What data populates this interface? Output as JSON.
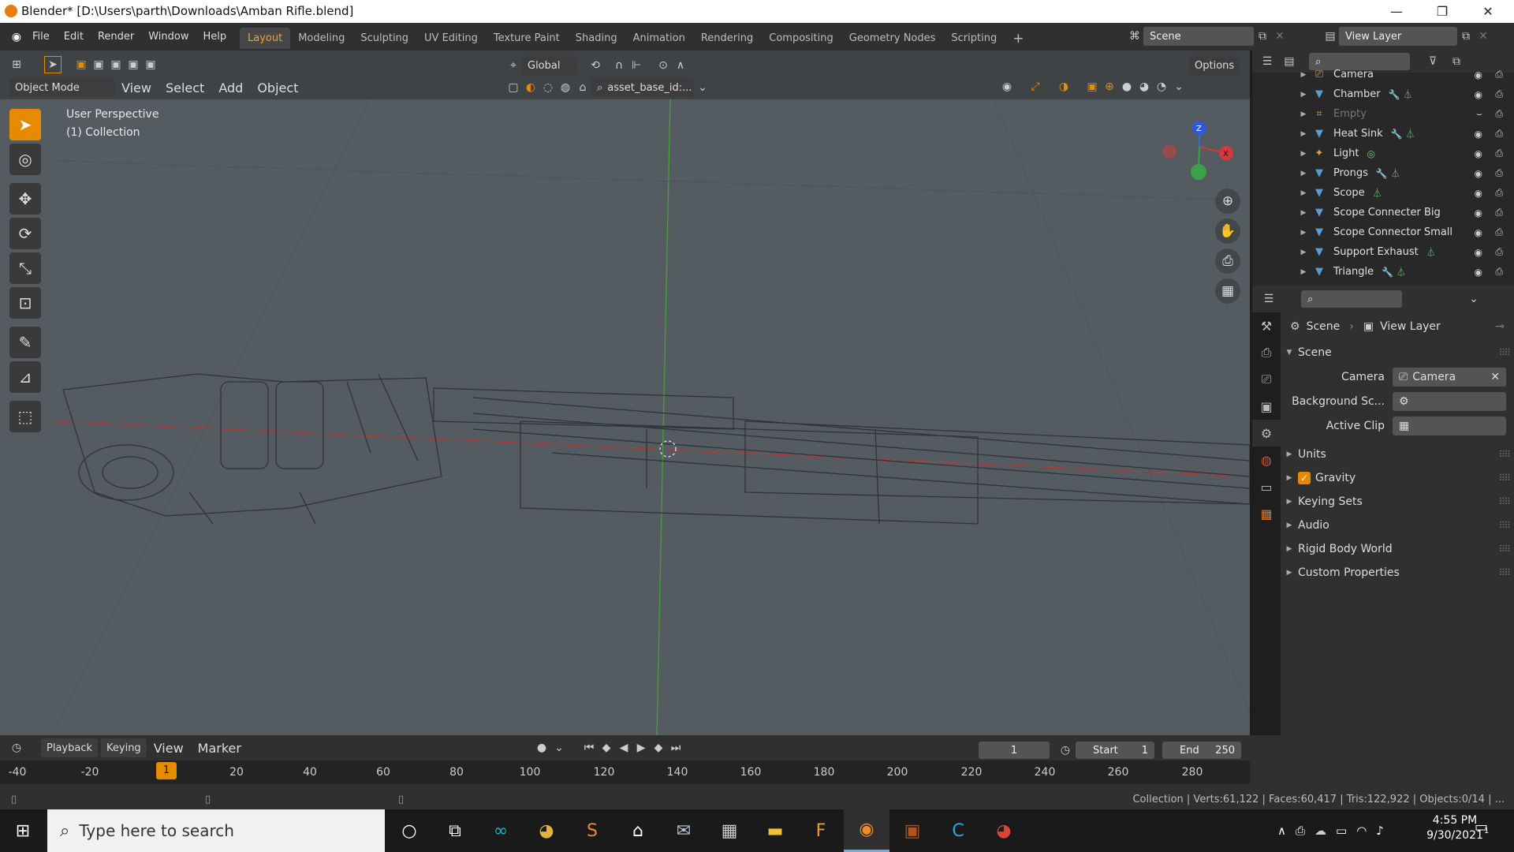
{
  "window": {
    "title": "Blender* [D:\\Users\\parth\\Downloads\\Amban Rifle.blend]",
    "minimize": "—",
    "maximize": "❐",
    "close": "✕"
  },
  "menus": [
    "File",
    "Edit",
    "Render",
    "Window",
    "Help"
  ],
  "workspaces": [
    "Layout",
    "Modeling",
    "Sculpting",
    "UV Editing",
    "Texture Paint",
    "Shading",
    "Animation",
    "Rendering",
    "Compositing",
    "Geometry Nodes",
    "Scripting"
  ],
  "active_workspace": "Layout",
  "scene_field": "Scene",
  "view_layer_field": "View Layer",
  "viewport": {
    "transform_orientation": "Global",
    "options_label": "Options",
    "mode": "Object Mode",
    "header_menus": [
      "View",
      "Select",
      "Add",
      "Object"
    ],
    "asset_field": "asset_base_id:...",
    "perspective_label": "User Perspective",
    "collection_label": "(1) Collection",
    "gizmo": {
      "x": "X",
      "y": "Y",
      "z": "Z"
    }
  },
  "outliner": {
    "items": [
      {
        "label": "Camera",
        "icon": "camera-icon",
        "dim": false,
        "extra": ""
      },
      {
        "label": "Chamber",
        "icon": "mesh-icon",
        "dim": false,
        "extra": "modifier-icon mesh-data-icon"
      },
      {
        "label": "Empty",
        "icon": "empty-icon",
        "dim": true,
        "extra": ""
      },
      {
        "label": "Heat Sink",
        "icon": "mesh-icon",
        "dim": false,
        "extra": "modifier-icon mesh-data-icon"
      },
      {
        "label": "Light",
        "icon": "light-icon",
        "dim": false,
        "extra": "light-data-icon"
      },
      {
        "label": "Prongs",
        "icon": "mesh-icon",
        "dim": false,
        "extra": "modifier-icon mesh-data-icon"
      },
      {
        "label": "Scope",
        "icon": "mesh-icon",
        "dim": false,
        "extra": "mesh-data-icon"
      },
      {
        "label": "Scope Connecter Big",
        "icon": "mesh-icon",
        "dim": false,
        "extra": ""
      },
      {
        "label": "Scope Connector Small",
        "icon": "mesh-icon",
        "dim": false,
        "extra": ""
      },
      {
        "label": "Support Exhaust",
        "icon": "mesh-icon",
        "dim": false,
        "extra": "mesh-data-icon"
      },
      {
        "label": "Triangle",
        "icon": "mesh-icon",
        "dim": false,
        "extra": "modifier-icon mesh-data-icon"
      }
    ]
  },
  "properties": {
    "breadcrumb_scene": "Scene",
    "breadcrumb_view_layer": "View Layer",
    "section_scene": "Scene",
    "camera_label": "Camera",
    "camera_value": "Camera",
    "background_label": "Background Sc...",
    "active_clip_label": "Active Clip",
    "sections": [
      "Units",
      "Gravity",
      "Keying Sets",
      "Audio",
      "Rigid Body World",
      "Custom Properties"
    ],
    "gravity_checked": true
  },
  "timeline": {
    "menus": [
      "Playback",
      "Keying",
      "View",
      "Marker"
    ],
    "current_frame": "1",
    "start_label": "Start",
    "start_value": "1",
    "end_label": "End",
    "end_value": "250",
    "ruler_ticks": [
      "-40",
      "-20",
      "1",
      "20",
      "40",
      "60",
      "80",
      "100",
      "120",
      "140",
      "160",
      "180",
      "200",
      "220",
      "240",
      "260",
      "280"
    ]
  },
  "status_bar": "Collection | Verts:61,122 | Faces:60,417 | Tris:122,922 | Objects:0/14 | ...",
  "taskbar": {
    "search_placeholder": "Type here to search",
    "time": "4:55 PM",
    "date": "9/30/2021",
    "notifications": "1"
  }
}
